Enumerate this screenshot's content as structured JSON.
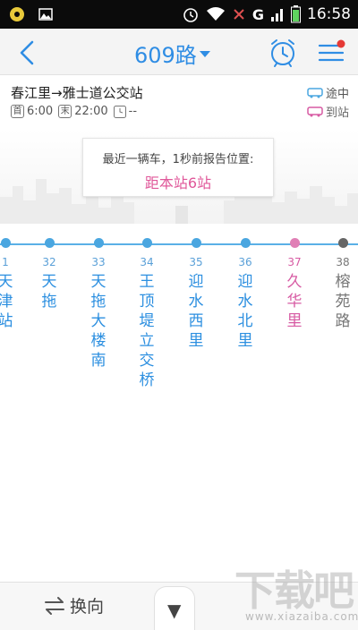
{
  "status_bar": {
    "time": "16:58",
    "network": "G"
  },
  "header": {
    "title": "609路"
  },
  "info": {
    "direction": "春江里→雅士道公交站",
    "first_tag": "首",
    "first_time": "6:00",
    "last_tag": "末",
    "last_time": "22:00",
    "extra": "--",
    "legend_running": "途中",
    "legend_arrived": "到站"
  },
  "notice": {
    "line1": "最近一辆车，1秒前报告位置:",
    "line2": "距本站6站"
  },
  "stations": [
    {
      "num": "1",
      "name": "天津站",
      "state": "past"
    },
    {
      "num": "32",
      "name": "天拖",
      "state": "past"
    },
    {
      "num": "33",
      "name": "天拖大楼南",
      "state": "past"
    },
    {
      "num": "34",
      "name": "王顶堤立交桥",
      "state": "past"
    },
    {
      "num": "35",
      "name": "迎水西里",
      "state": "past"
    },
    {
      "num": "36",
      "name": "迎水北里",
      "state": "past"
    },
    {
      "num": "37",
      "name": "久华里",
      "state": "current"
    },
    {
      "num": "38",
      "name": "榕苑路",
      "state": "future"
    }
  ],
  "footer": {
    "reverse_label": "换向",
    "fav_label": "▼"
  },
  "watermark": {
    "text": "下载吧",
    "sub": "www.xiazaiba.com"
  },
  "icons": {
    "back": "chevron-left-icon",
    "dropdown": "caret-down-icon",
    "alarm": "alarm-clock-icon",
    "menu": "hamburger-menu-icon",
    "notify_color": "#e53935",
    "accent": "#2f8de4",
    "current_color": "#d75aa3"
  }
}
